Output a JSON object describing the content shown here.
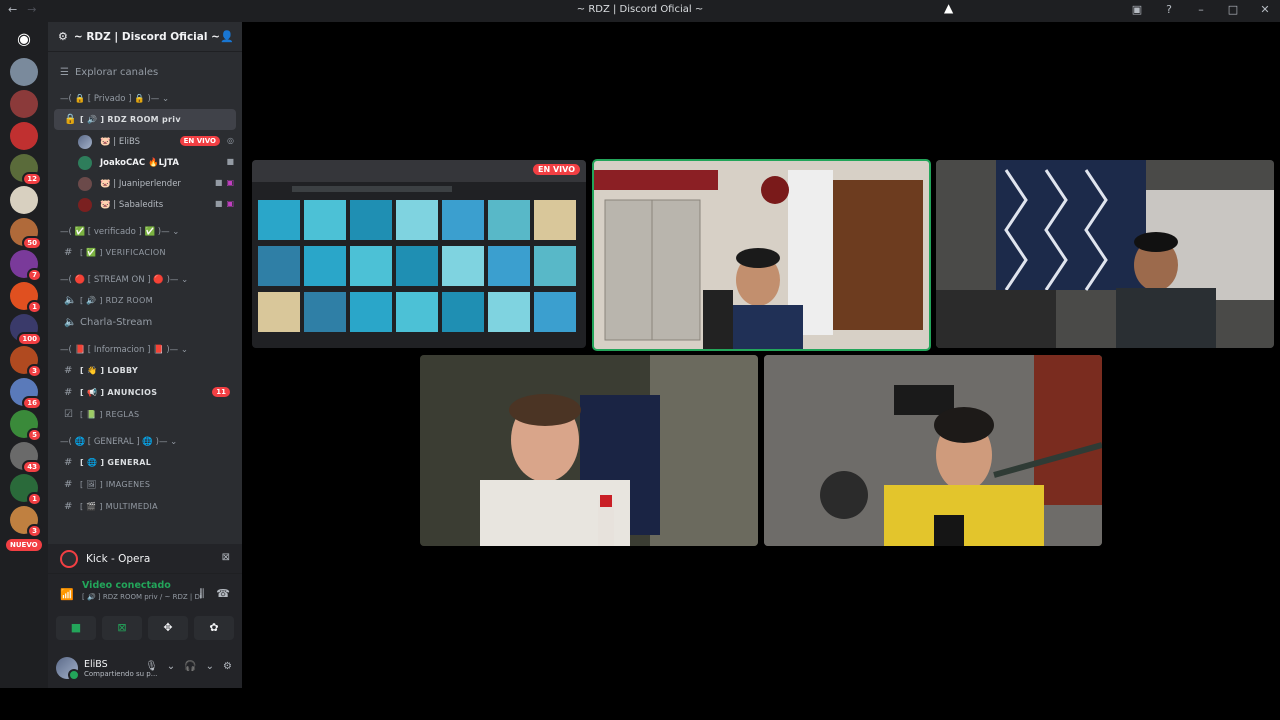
{
  "window": {
    "title": "~ RDZ | Discord Oficial ~",
    "back_icon": "arrow-left-icon",
    "forward_icon": "arrow-right-icon"
  },
  "guilds": {
    "badges": [
      "",
      "",
      "",
      "12",
      "",
      "50",
      "7",
      "1",
      "100",
      "3",
      "16",
      "5",
      "43",
      "1",
      "3"
    ],
    "nuevo_label": "NUEVO"
  },
  "server": {
    "name": "~ RDZ | Discord Oficial ~"
  },
  "explore_label": "Explorar canales",
  "categories": {
    "privado": "—( 🔒 [ Privado ] 🔒 )— ⌄",
    "verificado": "—( ✅ [ verificado ] ✅ )— ⌄",
    "stream": "—( 🔴 [ STREAM ON ] 🔴 )— ⌄",
    "informacion": "—( 📕 [ Informacion ] 📕 )— ⌄",
    "general": "—( 🌐 [ GENERAL ] 🌐 )— ⌄"
  },
  "channels": {
    "room_priv": "[ 🔊 ] RDZ ROOM priv",
    "verificacion": "[ ✅ ] VERIFICACION",
    "rdz_room": "[ 🔊 ] RDZ ROOM",
    "charla_stream": "Charla-Stream",
    "lobby": "[ 👋 ] LOBBY",
    "anuncios": "[ 📢 ] ANUNCIOS",
    "anuncios_unread": "11",
    "reglas": "[ 📗 ] REGLAS",
    "general": "[ 🌐 ] GENERAL",
    "imagenes": "[ 🖼 ] IMAGENES",
    "multimedia": "[ 🎬 ] MULTIMEDIA"
  },
  "voice_users": [
    {
      "name": "🐷 | EliBS",
      "live": "EN VIVO"
    },
    {
      "name": "JoakoCAC 🔥LJTA",
      "live": ""
    },
    {
      "name": "🐷 | Juaniperlender",
      "live": ""
    },
    {
      "name": "🐷 | Sabaledits",
      "live": ""
    }
  ],
  "panel": {
    "activity": "Kick - Opera",
    "voice_status": "Video conectado",
    "voice_channel": "[ 🔊 ] RDZ ROOM priv / ~ RDZ | Discor...",
    "user_name": "EliBS",
    "user_status": "Compartiendo su p..."
  },
  "stage": {
    "live_label": "EN VIVO"
  },
  "colors": {
    "accent_green": "#23a55a",
    "live_red": "#f23f43",
    "sidebar_bg": "#2b2d31",
    "rail_bg": "#1e1f22"
  }
}
